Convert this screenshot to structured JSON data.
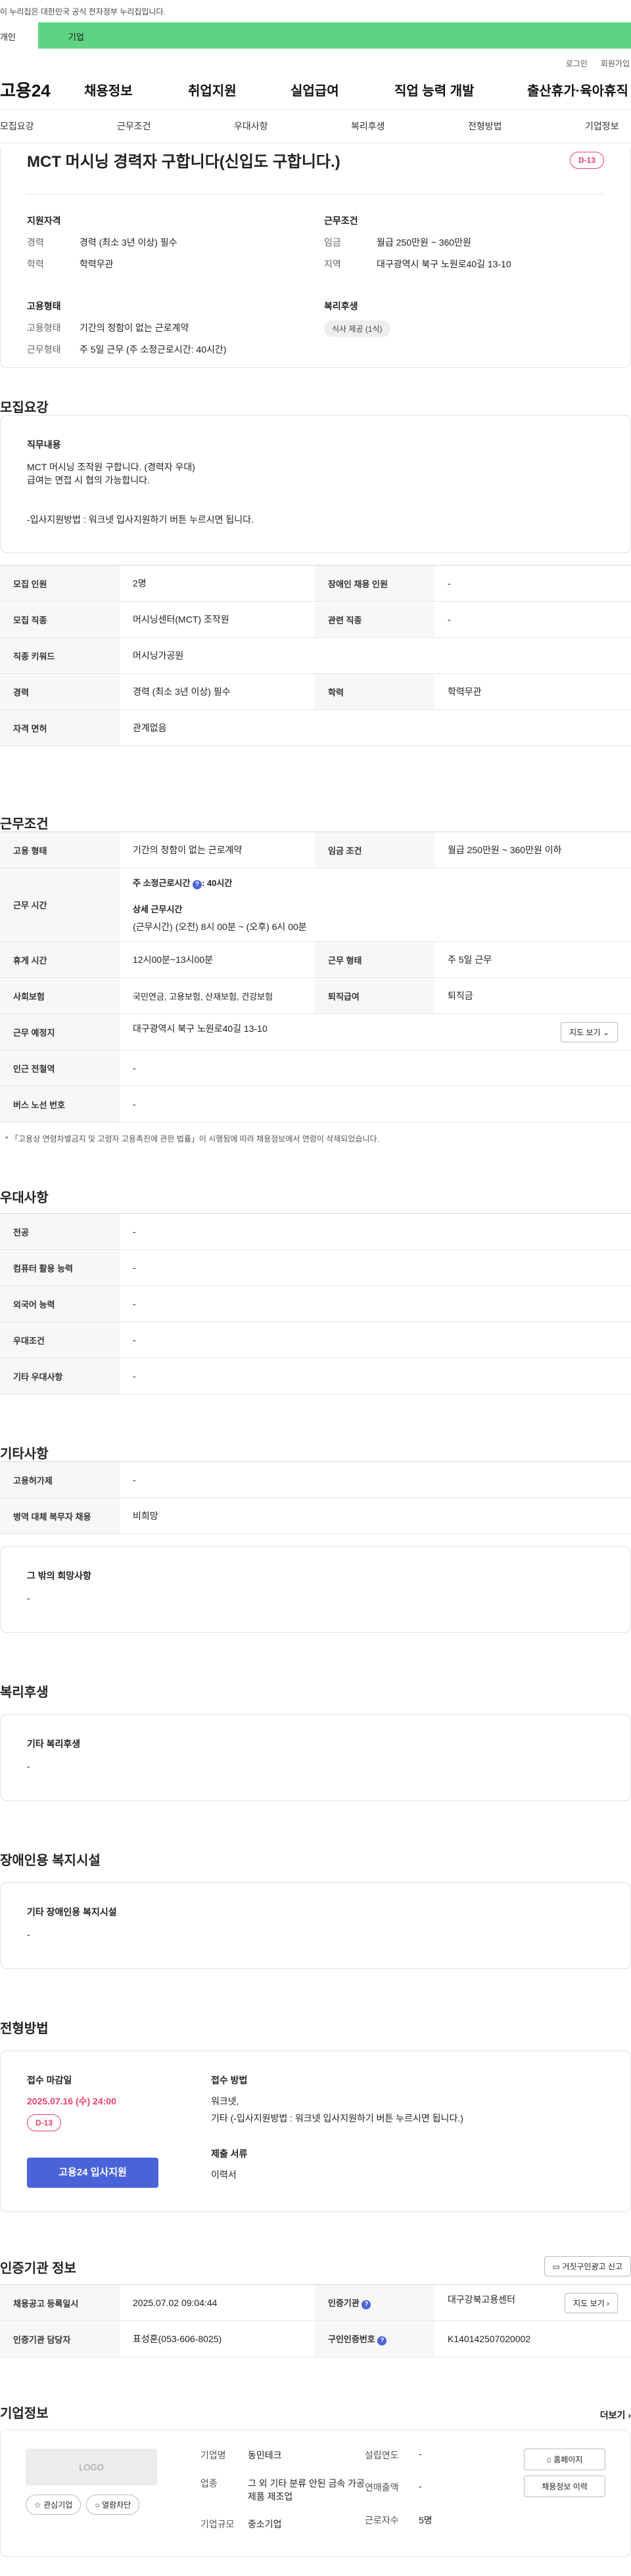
{
  "gov_banner": "이 누리집은 대한민국 공식 전자정부 누리집입니다.",
  "member_tabs": [
    "개인",
    "기업"
  ],
  "util_links": [
    "로그인",
    "회원가입"
  ],
  "brand": "고용24",
  "gnb": [
    "채용정보",
    "취업지원",
    "실업급여",
    "직업 능력 개발",
    "출산휴가·육아휴직"
  ],
  "lnb": [
    "모집요강",
    "근무조건",
    "우대사항",
    "복리후생",
    "전형방법",
    "기업정보"
  ],
  "job_title": "MCT 머시닝 경력자 구합니다(신입도 구합니다.)",
  "dday": "D-13",
  "summary": {
    "qual_title": "지원자격",
    "qual": [
      {
        "k": "경력",
        "v": "경력 (최소 3년 이상) 필수"
      },
      {
        "k": "학력",
        "v": "학력무관"
      }
    ],
    "emp_title": "고용형태",
    "emp": [
      {
        "k": "고용형태",
        "v": "기간의 정함이 없는 근로계약"
      },
      {
        "k": "근무형태",
        "v": "주 5일 근무 (주 소정근로시간: 40시간)"
      }
    ],
    "cond_title": "근무조건",
    "cond": [
      {
        "k": "임금",
        "v": "월급 250만원 ~ 360만원"
      },
      {
        "k": "지역",
        "v": "대구광역시 북구 노원로40길 13-10"
      }
    ],
    "welfare_title": "복리후생",
    "welfare_chip": "식사 제공 (1식)"
  },
  "recruit": {
    "title": "모집요강",
    "duty_title": "직무내용",
    "duty_lines": [
      "MCT 머시닝 조작원 구합니다. (경력자 우대)",
      "급여는 면접 시 협의 가능합니다.",
      "",
      "",
      "-입사지원방법 : 워크넷 입사지원하기 버튼 누르시면 됩니다."
    ],
    "rows": [
      [
        "모집 인원",
        "2명",
        "장애인 채용 인원",
        "-"
      ],
      [
        "모집 직종",
        "머시닝센터(MCT) 조작원",
        "관련 직종",
        "-"
      ],
      [
        "직종 키워드",
        "머시닝가공원",
        "",
        ""
      ],
      [
        "경력",
        "경력 (최소 3년 이상) 필수",
        "학력",
        "학력무관"
      ],
      [
        "자격 면허",
        "관계없음",
        "",
        ""
      ]
    ]
  },
  "work": {
    "title": "근무조건",
    "emp_type_h": "고용 형태",
    "emp_type_v": "기간의 정함이 없는 근로계약",
    "wage_h": "임금 조건",
    "wage_v": "월급 250만원 ~ 360만원 이하",
    "hours_h": "근무 시간",
    "hours_l1": "주 소정근로시간",
    "hours_l1v": ": 40시간",
    "hours_l2": "상세 근무시간",
    "hours_l3": "(근무시간) (오전) 8시 00분 ~ (오후) 6시 00분",
    "break_h": "휴게 시간",
    "break_v": "12시00분~13시00분",
    "form_h": "근무 형태",
    "form_v": "주 5일 근무",
    "ins_h": "사회보험",
    "ins_v": "국민연금, 고용보험, 산재보험, 건강보험",
    "sev_h": "퇴직급여",
    "sev_v": "퇴직금",
    "place_h": "근무 예정지",
    "place_v": "대구광역시 북구 노원로40길 13-10",
    "map_btn": "지도 보기",
    "subway_h": "인근 전철역",
    "subway_v": "-",
    "bus_h": "버스 노선 번호",
    "bus_v": "-",
    "note": "* 「고용상 연령차별금지 및 고령자 고용촉진에 관한 법률」이 시행됨에 따라 채용정보에서 연령이 삭제되었습니다."
  },
  "prefer": {
    "title": "우대사항",
    "rows": [
      [
        "전공",
        "-"
      ],
      [
        "컴퓨터 활용 능력",
        "-"
      ],
      [
        "외국어 능력",
        "-"
      ],
      [
        "우대조건",
        "-"
      ],
      [
        "기타 우대사항",
        "-"
      ]
    ]
  },
  "etc": {
    "title": "기타사항",
    "rows": [
      [
        "고용허가제",
        "-"
      ],
      [
        "병역 대체 복무자 채용",
        "비희망"
      ]
    ],
    "other_title": "그 밖의 희망사항",
    "other_v": "-"
  },
  "welfare": {
    "title": "복리후생",
    "box_title": "기타 복리후생",
    "box_v": "-"
  },
  "disab": {
    "title": "장애인용 복지시설",
    "box_title": "기타 장애인용 복지시설",
    "box_v": "-"
  },
  "selection": {
    "title": "전형방법",
    "deadline_label": "접수 마감일",
    "deadline": "2025.07.16 (수) 24:00",
    "dday": "D-13",
    "apply_btn": "고용24 입사지원",
    "method_label": "접수 방법",
    "method_1": "워크넷,",
    "method_2": "기타 (-입사지원방법 : 워크넷 입사지원하기 버튼 누르시면 됩니다.)",
    "docs_label": "제출 서류",
    "docs_v": "이력서"
  },
  "agency": {
    "title": "인증기관 정보",
    "report_btn": "거짓구인광고 신고",
    "reg_h": "채용공고 등록일시",
    "reg_v": "2025.07.02 09:04:44",
    "org_h": "인증기관",
    "org_v": "대구강북고용센터",
    "map_btn": "지도 보기",
    "mgr_h": "인증기관 담당자",
    "mgr_v": "표성훈(053-606-8025)",
    "no_h": "구인인증번호",
    "no_v": "K140142507020002"
  },
  "company": {
    "title": "기업정보",
    "more": "더보기",
    "logo": "LOGO",
    "interest_btn": "관심기업",
    "block_btn": "열람차단",
    "name_k": "기업명",
    "name_v": "동민테크",
    "biz_k": "업종",
    "biz_v": "그 외 기타 분류 안된 금속 가공 제품 제조업",
    "size_k": "기업규모",
    "size_v": "중소기업",
    "est_k": "설립연도",
    "est_v": "-",
    "sales_k": "연매출액",
    "sales_v": "-",
    "emp_k": "근로자수",
    "emp_v": "5명",
    "home_btn": "홈페이지",
    "hist_btn": "채용정보 이력"
  },
  "colors": {
    "green": "#5ed483",
    "red": "#e8416b",
    "blue": "#4b63d9"
  }
}
